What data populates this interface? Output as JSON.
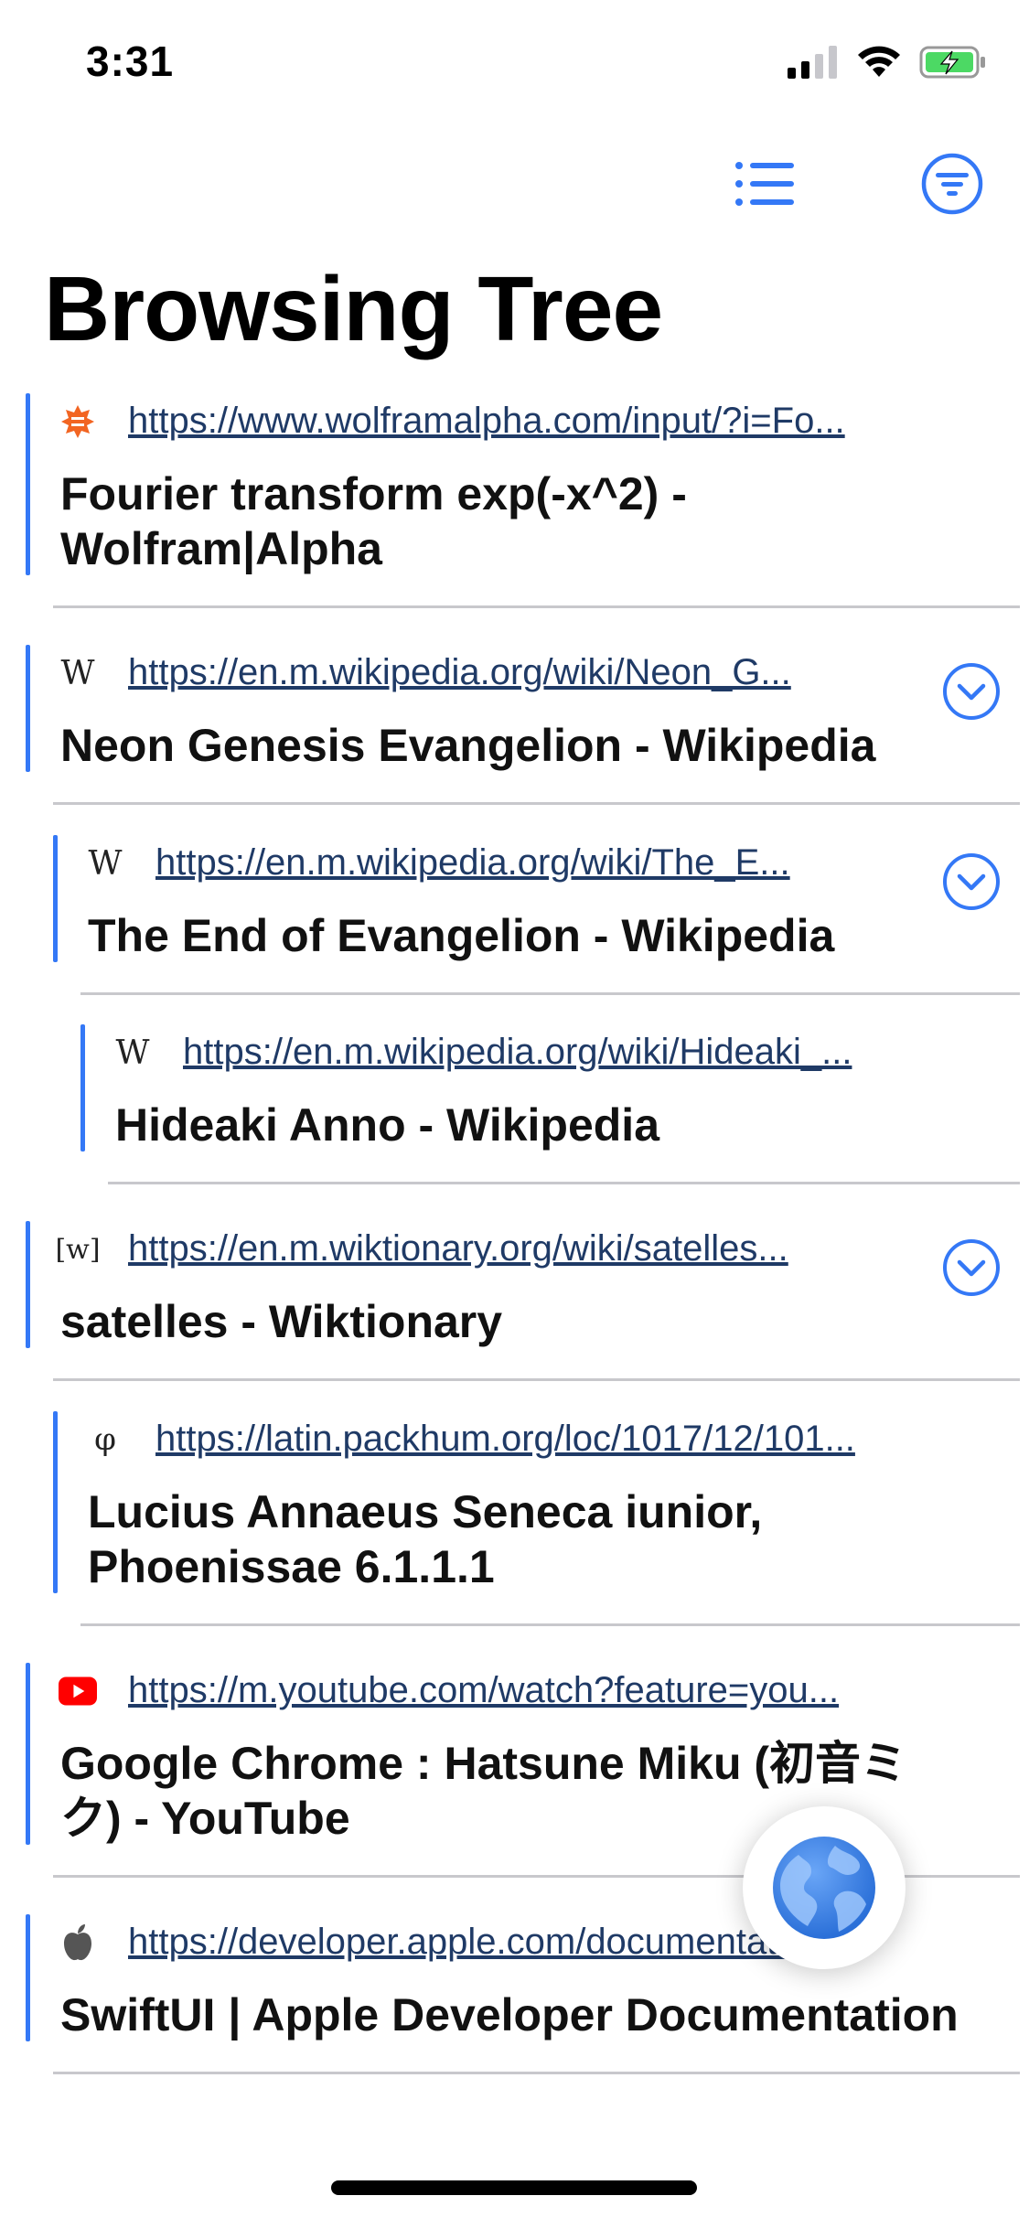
{
  "status": {
    "time": "3:31"
  },
  "header": {
    "title": "Browsing Tree"
  },
  "items": [
    {
      "url": "https://www.wolframalpha.com/input/?i=Fo...",
      "title": "Fourier transform exp(-x^2) - Wolfram|Alpha",
      "favicon": "wolfram-icon",
      "depth": 0,
      "chevron": false
    },
    {
      "url": "https://en.m.wikipedia.org/wiki/Neon_G...",
      "title": "Neon Genesis Evangelion - Wikipedia",
      "favicon": "wikipedia-icon",
      "favicon_text": "W",
      "depth": 0,
      "chevron": true
    },
    {
      "url": "https://en.m.wikipedia.org/wiki/The_E...",
      "title": "The End of Evangelion - Wikipedia",
      "favicon": "wikipedia-icon",
      "favicon_text": "W",
      "depth": 1,
      "chevron": true
    },
    {
      "url": "https://en.m.wikipedia.org/wiki/Hideaki_...",
      "title": "Hideaki Anno - Wikipedia",
      "favicon": "wikipedia-icon",
      "favicon_text": "W",
      "depth": 2,
      "chevron": false
    },
    {
      "url": "https://en.m.wiktionary.org/wiki/satelles...",
      "title": "satelles - Wiktionary",
      "favicon": "wiktionary-icon",
      "favicon_text": "[w]",
      "depth": 0,
      "chevron": true
    },
    {
      "url": "https://latin.packhum.org/loc/1017/12/101...",
      "title": "Lucius Annaeus Seneca iunior, Phoenissae 6.1.1.1",
      "favicon": "phi-icon",
      "favicon_text": "φ",
      "depth": 1,
      "chevron": false
    },
    {
      "url": "https://m.youtube.com/watch?feature=you...",
      "title": "Google Chrome : Hatsune Miku (初音ミク) - YouTube",
      "favicon": "youtube-icon",
      "depth": 0,
      "chevron": false
    },
    {
      "url": "https://developer.apple.com/documentatio...",
      "title": "SwiftUI | Apple Developer Documentation",
      "favicon": "apple-icon",
      "depth": 0,
      "chevron": false
    }
  ],
  "colors": {
    "accent": "#3478f6",
    "link": "#1f3a66",
    "battery": "#4cd964"
  }
}
